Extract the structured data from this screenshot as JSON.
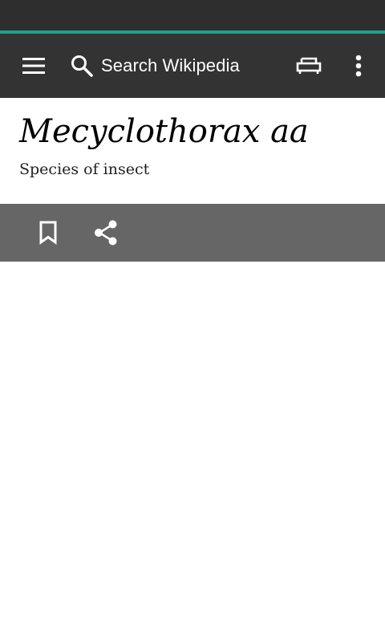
{
  "colors": {
    "status_bar": "#2e2e2e",
    "accent": "#1aa389",
    "toolbar": "#333333",
    "action_bar": "#666666",
    "icon": "#ffffff"
  },
  "toolbar": {
    "menu_icon": "hamburger-menu-icon",
    "search_icon": "search-icon",
    "search_placeholder": "Search Wikipedia",
    "tabs_icon": "tabs-icon",
    "overflow_icon": "more-vert-icon"
  },
  "article": {
    "title": "Mecyclothorax aa",
    "description": "Species of insect"
  },
  "actions": {
    "bookmark_icon": "bookmark-icon",
    "share_icon": "share-icon"
  }
}
